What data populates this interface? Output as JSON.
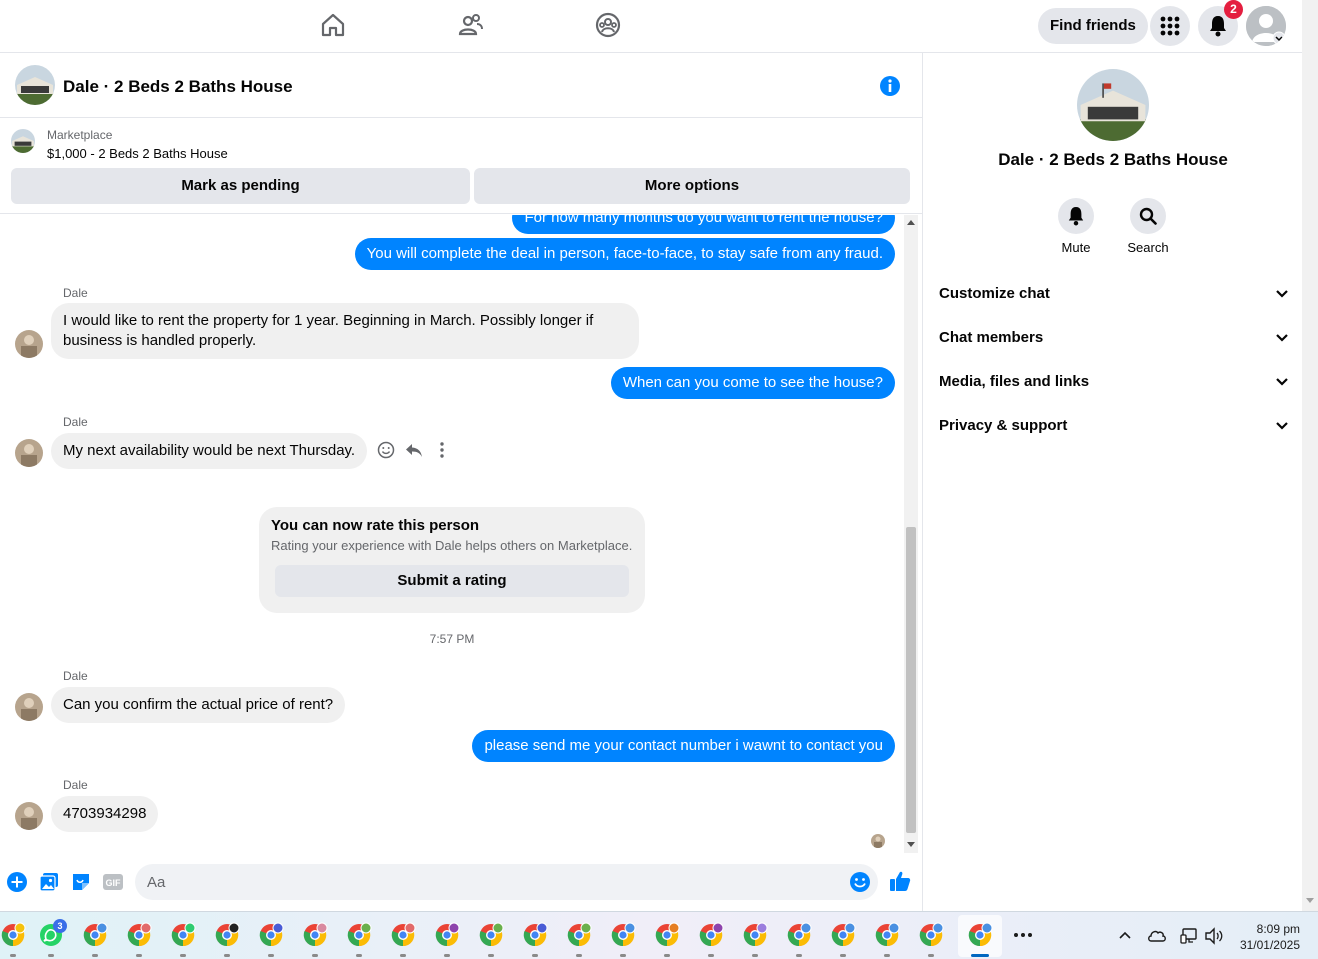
{
  "topnav": {
    "find_friends": "Find friends",
    "notification_count": "2"
  },
  "chat": {
    "title": "Dale · 2 Beds 2 Baths House",
    "listing_source": "Marketplace",
    "listing_price": "$1,000 - 2 Beds 2 Baths House",
    "mark_pending": "Mark as pending",
    "more_options": "More options"
  },
  "messages": {
    "m1": "For how many months do you want to rent the house?",
    "m2": "You will complete the deal in person, face-to-face, to stay safe from any fraud.",
    "sender": "Dale",
    "m3_line1": "I would like to rent the property for 1 year. Beginning in March. Possibly longer if",
    "m3_line2": "business is handled properly.",
    "m4": "When can you come to see the house?",
    "m5": "My next availability would be next Thursday.",
    "rate_title": "You can now rate this person",
    "rate_sub": "Rating your experience with Dale helps others on Marketplace.",
    "rate_button": "Submit a rating",
    "timestamp": "7:57 PM",
    "m6": "Can you confirm the actual price of rent?",
    "m7": "please send me your contact number i  wawnt to contact you",
    "m8": "4703934298"
  },
  "composer": {
    "placeholder": "Aa"
  },
  "right_panel": {
    "title": "Dale · 2 Beds 2 Baths House",
    "mute": "Mute",
    "search": "Search",
    "rows": [
      "Customize chat",
      "Chat members",
      "Media, files and links",
      "Privacy & support"
    ]
  },
  "taskbar": {
    "whatsapp_badge": "3",
    "time": "8:09 pm",
    "date": "31/01/2025"
  },
  "colors": {
    "accent": "#0084ff",
    "bubble_in": "#f0f0f0",
    "badge": "#e41e3f"
  }
}
